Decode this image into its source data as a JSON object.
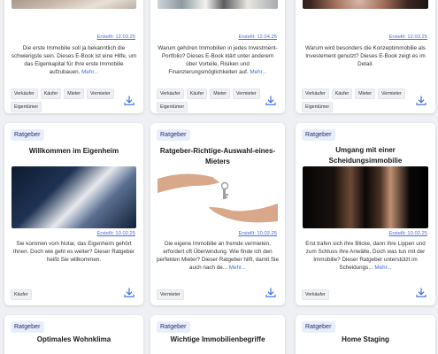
{
  "cards": [
    {
      "date": "Erstellt: 12.03.25",
      "description": "Die erste Immobilie soll ja bekanntlich die schwierigste sein. Dieses E-Book ist eine Hilfe, um das Eigenkapital für Ihre erste Immobilie aufzubauen.",
      "more": "Mehr...",
      "tags": [
        "Verkäufer",
        "Käufer",
        "Mieter",
        "Vermieter",
        "Eigentümer"
      ],
      "image_icon": "house-exterior-image"
    },
    {
      "date": "Erstellt: 12.04.25",
      "description": "Warum gehören Immobilien in jedes Investment-Portfolio? Dieses E-Book klärt unter anderem über Vorteile, Risiken und Finanzierungsmöglichkeiten auf.",
      "more": "Mehr...",
      "tags": [
        "Verkäufer",
        "Käufer",
        "Mieter",
        "Vermieter",
        "Eigentümer"
      ],
      "image_icon": "interior-image"
    },
    {
      "date": "Erstellt: 12.03.25",
      "description": "Warum wird besonders die Konzeptimmobilie als Investement genutzt? Dieses E-Book zeigt es im Detail.",
      "more": "",
      "tags": [
        "Verkäufer",
        "Käufer",
        "Mieter",
        "Vermieter",
        "Eigentümer"
      ],
      "image_icon": "surprised-face-image"
    },
    {
      "badge": "Ratgeber",
      "title": "Willkommen im Eigenheim",
      "date": "Erstellt: 10.02.25",
      "description": "Sie kommen vom Notar, das Eigenheim gehört Ihnen. Doch wie geht es weiter? Dieser Ratgeber heißt Sie willkommen.",
      "more": "",
      "tags": [
        "Käufer"
      ],
      "image_icon": "signing-contract-image"
    },
    {
      "badge": "Ratgeber",
      "title": "Ratgeber-Richtige-Auswahl-eines-Mieters",
      "date": "Erstellt: 10.02.25",
      "description": "Die eigene Immobilie an fremde vermieten, erfordert oft Überwindung. Wie finde ich den perfekten Mieter? Dieser Ratgeber hilft, damit Sie auch nach de...",
      "more": "Mehr...",
      "tags": [
        "Vermieter"
      ],
      "image_icon": "key-handover-image"
    },
    {
      "badge": "Ratgeber",
      "title": "Umgang mit einer Scheidungsimmobilie",
      "date": "Erstellt: 10.02.25",
      "description": "Erst trafen sich ihre Blicke, dann ihre Lippen und zum Schluss ihre Anwälte. Doch was tun mit der Immobilie? Dieser Ratgeber unterstützt im Scheidungs...",
      "more": "Mehr...",
      "tags": [
        "Verkäufer"
      ],
      "image_icon": "couple-silhouette-image"
    },
    {
      "badge": "Ratgeber",
      "title": "Optimales Wohnklima"
    },
    {
      "badge": "Ratgeber",
      "title": "Wichtige Immobilienbegriffe"
    },
    {
      "badge": "Ratgeber",
      "title": "Home Staging"
    }
  ],
  "colors": {
    "accent": "#3b6fe0",
    "badge_bg": "#e8eefb",
    "page_bg": "#eef0f4"
  }
}
